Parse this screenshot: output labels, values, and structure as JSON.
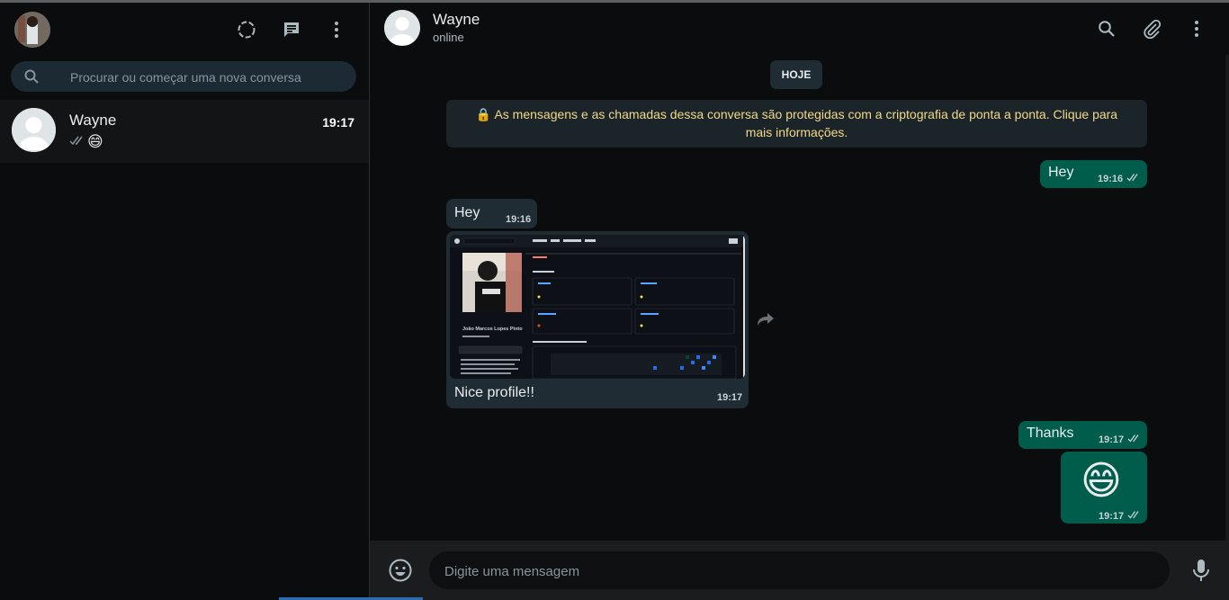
{
  "sidebar": {
    "search_placeholder": "Procurar ou começar uma nova conversa",
    "chats": [
      {
        "name": "Wayne",
        "time": "19:17",
        "preview_emoji": "😄"
      }
    ]
  },
  "conversation": {
    "contact_name": "Wayne",
    "status": "online",
    "date_chip": "HOJE",
    "encryption_notice": "🔒 As mensagens e as chamadas dessa conversa são protegidas com a criptografia de ponta a ponta. Clique para mais informações.",
    "messages": [
      {
        "direction": "out",
        "text": "Hey",
        "time": "19:16"
      },
      {
        "direction": "in",
        "text": "Hey",
        "time": "19:16"
      },
      {
        "direction": "in",
        "type": "image",
        "caption": "Nice profile!!",
        "time": "19:17"
      },
      {
        "direction": "out",
        "text": "Thanks",
        "time": "19:17"
      },
      {
        "direction": "out",
        "type": "emoji",
        "text": "😄",
        "time": "19:17"
      }
    ],
    "thumbnail_profile_name": "João Marcos Lopes Pinto"
  },
  "composer": {
    "placeholder": "Digite uma mensagem"
  },
  "colors": {
    "outgoing_bubble": "#005c4b",
    "incoming_bubble": "#1f2c33",
    "notice_text": "#f2d88a",
    "background": "#0b0c0d"
  }
}
